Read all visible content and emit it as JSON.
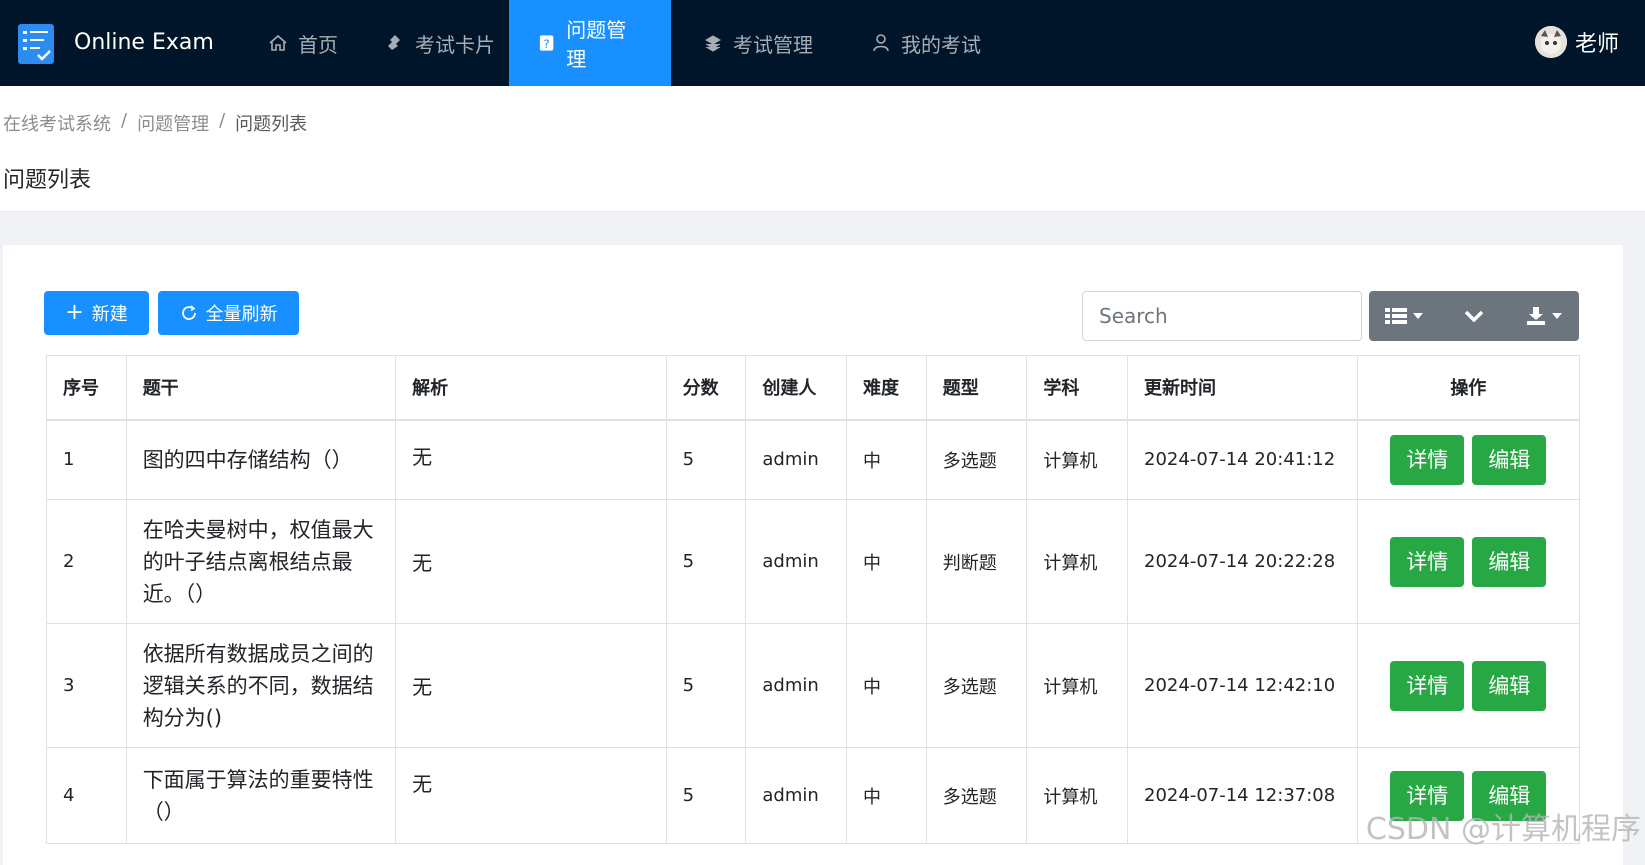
{
  "app": {
    "title": "Online Exam",
    "user_name": "老师"
  },
  "nav": [
    {
      "label": "首页",
      "icon": "home-icon"
    },
    {
      "label": "考试卡片",
      "icon": "stamp-icon"
    },
    {
      "label": "问题管理",
      "icon": "question-doc-icon",
      "active": true
    },
    {
      "label": "考试管理",
      "icon": "stack-icon"
    },
    {
      "label": "我的考试",
      "icon": "user-icon"
    }
  ],
  "breadcrumb": [
    "在线考试系统",
    "问题管理",
    "问题列表"
  ],
  "breadcrumb_sep": "/",
  "page_title": "问题列表",
  "toolbar": {
    "new_label": "新建",
    "refresh_label": "全量刷新",
    "search_placeholder": "Search"
  },
  "table": {
    "headers": [
      "序号",
      "题干",
      "解析",
      "分数",
      "创建人",
      "难度",
      "题型",
      "学科",
      "更新时间",
      "操作"
    ],
    "detail_label": "详情",
    "edit_label": "编辑",
    "rows": [
      {
        "no": "1",
        "stem": "图的四中存储结构（）",
        "analysis": "无",
        "score": "5",
        "creator": "admin",
        "difficulty": "中",
        "type": "多选题",
        "subject": "计算机",
        "updated": "2024-07-14 20:41:12"
      },
      {
        "no": "2",
        "stem": "在哈夫曼树中，权值最大的叶子结点离根结点最近。（）",
        "analysis": "无",
        "score": "5",
        "creator": "admin",
        "difficulty": "中",
        "type": "判断题",
        "subject": "计算机",
        "updated": "2024-07-14 20:22:28"
      },
      {
        "no": "3",
        "stem": "依据所有数据成员之间的逻辑关系的不同，数据结构分为()",
        "analysis": "无",
        "score": "5",
        "creator": "admin",
        "difficulty": "中",
        "type": "多选题",
        "subject": "计算机",
        "updated": "2024-07-14 12:42:10"
      },
      {
        "no": "4",
        "stem": "下面属于算法的重要特性（）",
        "analysis": "无",
        "score": "5",
        "creator": "admin",
        "difficulty": "中",
        "type": "多选题",
        "subject": "计算机",
        "updated": "2024-07-14 12:37:08"
      }
    ]
  },
  "watermark": "CSDN @计算机程序",
  "colors": {
    "nav_bg": "#001529",
    "nav_active": "#1890ff",
    "primary": "#1890ff",
    "success": "#28a745",
    "tool_gray": "#6c757d"
  }
}
